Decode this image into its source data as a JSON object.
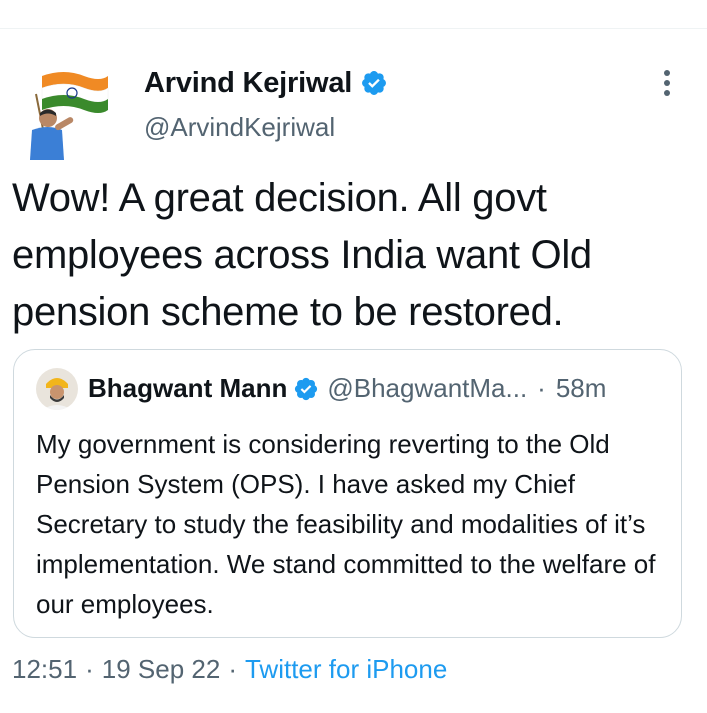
{
  "tweet": {
    "author_name": "Arvind Kejriwal",
    "author_handle": "@ArvindKejriwal",
    "text": "Wow! A great decision. All govt employees across India want Old pension scheme to be restored.",
    "time": "12:51",
    "date": "19 Sep 22",
    "source": "Twitter for iPhone",
    "separator": "·"
  },
  "quoted_tweet": {
    "author_name": "Bhagwant Mann",
    "author_handle": "@BhagwantMa...",
    "separator": "·",
    "time_ago": "58m",
    "text": "My government is considering reverting to the Old Pension System (OPS). I have asked my Chief Secretary to study the feasibility and modalities of it’s implementation. We stand committed to the welfare of our employees."
  },
  "icons": {
    "verified": "verified-badge-icon",
    "more": "more-options-icon"
  },
  "colors": {
    "text": "#0f1419",
    "secondary": "#536471",
    "accent": "#1d9bf0",
    "border": "#cfd9de"
  }
}
